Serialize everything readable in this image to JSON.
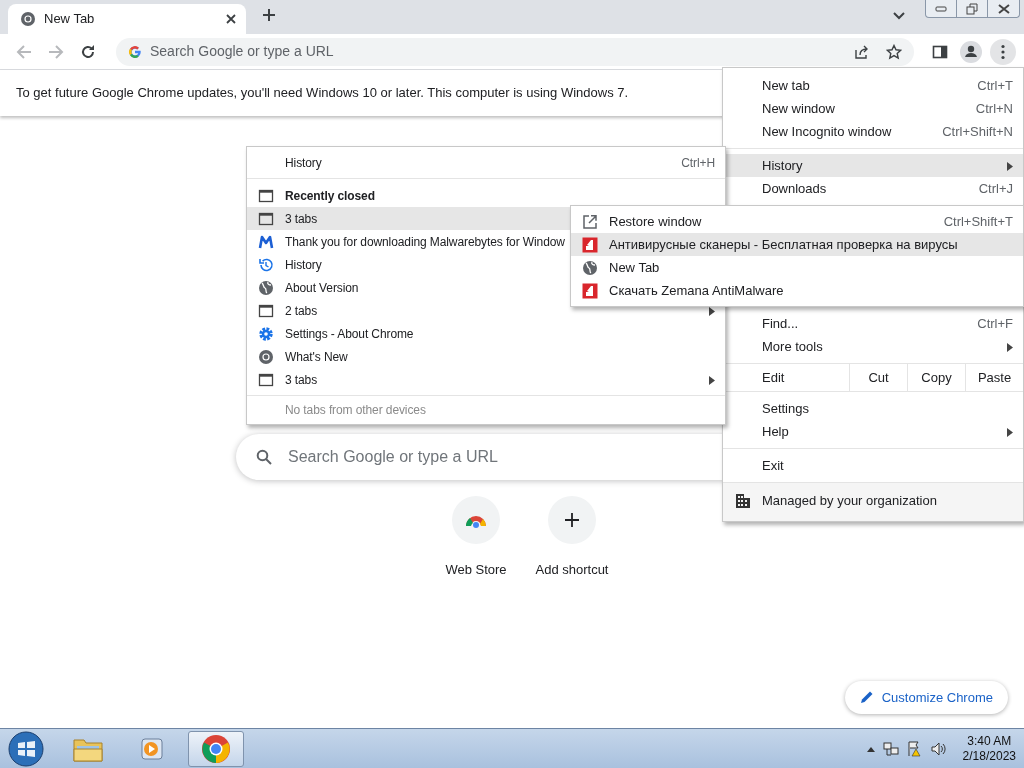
{
  "tabs": [
    {
      "title": "New Tab",
      "selected": true
    }
  ],
  "omnibox": {
    "placeholder": "Search Google or type a URL"
  },
  "infobar": {
    "text": "To get future Google Chrome updates, you'll need Windows 10 or later. This computer is using Windows 7."
  },
  "ntp": {
    "search_placeholder": "Search Google or type a URL",
    "shortcuts": [
      {
        "kind": "webstore",
        "label": "Web Store"
      },
      {
        "kind": "add",
        "label": "Add shortcut"
      }
    ],
    "customize_button": "Customize Chrome"
  },
  "app_menu": {
    "groups": [
      [
        {
          "kind": "item",
          "label": "New tab",
          "shortcut": "Ctrl+T",
          "submenu": false,
          "selected": false
        },
        {
          "kind": "item",
          "label": "New window",
          "shortcut": "Ctrl+N",
          "submenu": false,
          "selected": false
        },
        {
          "kind": "item",
          "label": "New Incognito window",
          "shortcut": "Ctrl+Shift+N",
          "submenu": false,
          "selected": false
        }
      ],
      [
        {
          "kind": "item",
          "label": "History",
          "submenu": true,
          "selected": true
        },
        {
          "kind": "item",
          "label": "Downloads",
          "shortcut": "Ctrl+J",
          "submenu": false,
          "selected": false
        }
      ],
      [
        {
          "kind": "item",
          "label": "Find...",
          "shortcut": "Ctrl+F",
          "submenu": false,
          "selected": false
        },
        {
          "kind": "item",
          "label": "More tools",
          "submenu": true,
          "selected": false
        }
      ],
      [
        {
          "kind": "edit",
          "label": "Edit",
          "actions": [
            "Cut",
            "Copy",
            "Paste"
          ]
        }
      ],
      [
        {
          "kind": "item",
          "label": "Settings",
          "submenu": false,
          "selected": false
        },
        {
          "kind": "item",
          "label": "Help",
          "submenu": true,
          "selected": false
        }
      ],
      [
        {
          "kind": "item",
          "label": "Exit",
          "submenu": false,
          "selected": false
        }
      ],
      [
        {
          "kind": "managed",
          "label": "Managed by your organization"
        }
      ]
    ]
  },
  "history_menu": {
    "groups": [
      [
        {
          "kind": "plain",
          "label": "History",
          "shortcut": "Ctrl+H",
          "submenu": false,
          "selected": false
        }
      ],
      [
        {
          "kind": "window",
          "label": "Recently closed",
          "submenu": false,
          "selected": false
        },
        {
          "kind": "window",
          "label": "3 tabs",
          "submenu": false,
          "selected": true
        },
        {
          "kind": "m-logo",
          "label": "Thank you for downloading Malwarebytes for Window",
          "submenu": false,
          "selected": false
        },
        {
          "kind": "clock",
          "label": "History",
          "submenu": false,
          "selected": false
        },
        {
          "kind": "globe",
          "label": "About Version",
          "submenu": false,
          "selected": false
        },
        {
          "kind": "window",
          "label": "2 tabs",
          "submenu": true,
          "selected": false
        },
        {
          "kind": "gear",
          "label": "Settings - About Chrome",
          "submenu": false,
          "selected": false
        },
        {
          "kind": "round-logo",
          "label": "What's New",
          "submenu": false,
          "selected": false
        },
        {
          "kind": "window",
          "label": "3 tabs",
          "submenu": true,
          "selected": false
        }
      ],
      [
        {
          "kind": "note",
          "label": "No tabs from other devices"
        }
      ]
    ]
  },
  "tabs_submenu": {
    "items": [
      {
        "kind": "restore",
        "label": "Restore window",
        "shortcut": "Ctrl+Shift+T",
        "selected": false
      },
      {
        "kind": "square-logo",
        "label": "Антивирусные сканеры - Бесплатная проверка на вирусы",
        "selected": true
      },
      {
        "kind": "globe",
        "label": "New Tab",
        "selected": false
      },
      {
        "kind": "square-logo",
        "label": "Скачать Zemana AntiMalware",
        "selected": false
      }
    ]
  },
  "taskbar": {
    "apps": [
      {
        "kind": "folder",
        "selected": false
      },
      {
        "kind": "player",
        "selected": false
      },
      {
        "kind": "browser",
        "selected": true
      }
    ],
    "time": "3:40 AM",
    "date": "2/18/2023"
  }
}
